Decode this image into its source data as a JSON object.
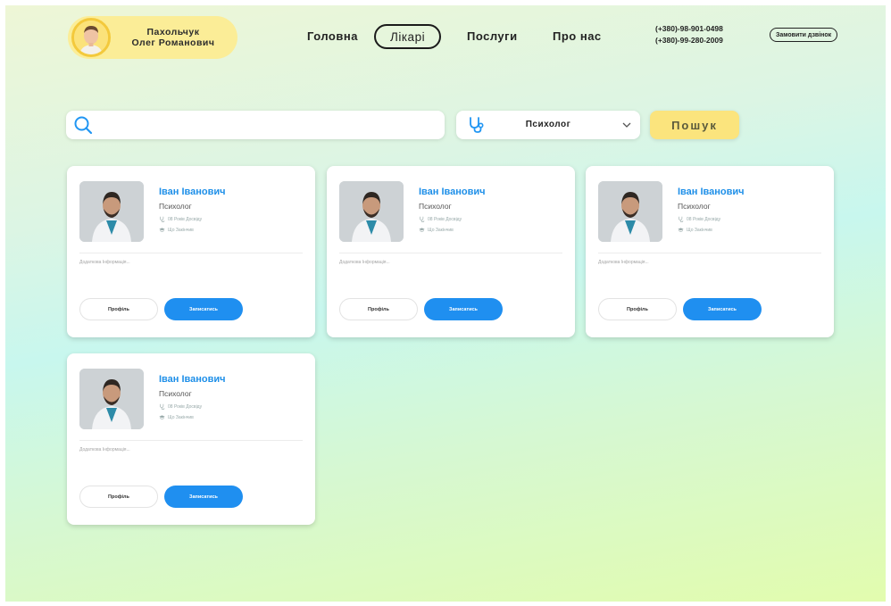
{
  "user": {
    "name_line1": "Пахольчук",
    "name_line2": "Олег Романович"
  },
  "nav": [
    {
      "label": "Головна",
      "active": false
    },
    {
      "label": "Лікарі",
      "active": true
    },
    {
      "label": "Послуги",
      "active": false
    },
    {
      "label": "Про нас",
      "active": false
    }
  ],
  "contacts": {
    "phone1": "(+380)-98-901-0498",
    "phone2": "(+380)-99-280-2009",
    "callback_label": "Замовити дзвінок"
  },
  "search": {
    "value": "",
    "placeholder": "",
    "specialty_selected": "Психолог",
    "button_label": "Пошук"
  },
  "doctors": [
    {
      "name": "Іван Іванович",
      "specialty": "Психолог",
      "experience": "08 Років Досвіду",
      "education": "Що Закінчив",
      "extra": "Додаткова Інформація...",
      "profile_label": "Профіль",
      "book_label": "Записатись"
    },
    {
      "name": "Іван Іванович",
      "specialty": "Психолог",
      "experience": "08 Років Досвіду",
      "education": "Що Закінчив",
      "extra": "Додаткова Інформація...",
      "profile_label": "Профіль",
      "book_label": "Записатись"
    },
    {
      "name": "Іван Іванович",
      "specialty": "Психолог",
      "experience": "08 Років Досвіду",
      "education": "Що Закінчив",
      "extra": "Додаткова Інформація...",
      "profile_label": "Профіль",
      "book_label": "Записатись"
    },
    {
      "name": "Іван Іванович",
      "specialty": "Психолог",
      "experience": "08 Років Досвіду",
      "education": "Що Закінчив",
      "extra": "Додаткова Інформація...",
      "profile_label": "Профіль",
      "book_label": "Записатись"
    }
  ],
  "colors": {
    "accent_blue": "#1f8ff0",
    "accent_yellow": "#fbe47d",
    "pill_yellow": "#fbed97"
  },
  "icons": {
    "search": "search-icon",
    "specialty": "stethoscope-icon",
    "dropdown": "chevron-down-icon",
    "experience": "stethoscope-icon",
    "education": "graduation-cap-icon"
  }
}
